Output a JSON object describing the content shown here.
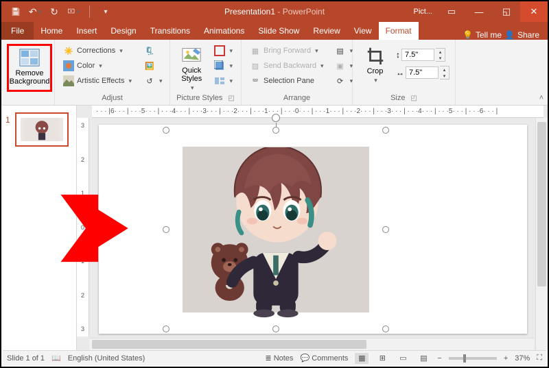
{
  "title": {
    "doc": "Presentation1",
    "app": "PowerPoint",
    "context": "Pict..."
  },
  "qat": {
    "save": "save-icon",
    "undo": "undo-icon",
    "redo": "redo-icon",
    "start": "startshow-icon"
  },
  "tabs": {
    "file": "File",
    "home": "Home",
    "insert": "Insert",
    "design": "Design",
    "transitions": "Transitions",
    "animations": "Animations",
    "slideshow": "Slide Show",
    "review": "Review",
    "view": "View",
    "format": "Format",
    "tellme": "Tell me",
    "share": "Share"
  },
  "ribbon": {
    "removebg": "Remove Background",
    "adjust": {
      "label": "Adjust",
      "corrections": "Corrections",
      "color": "Color",
      "artistic": "Artistic Effects"
    },
    "picstyles": {
      "label": "Picture Styles",
      "quick": "Quick Styles"
    },
    "arrange": {
      "label": "Arrange",
      "fwd": "Bring Forward",
      "bwd": "Send Backward",
      "pane": "Selection Pane"
    },
    "crop": "Crop",
    "size": {
      "label": "Size",
      "h": "7.5\"",
      "w": "7.5\""
    }
  },
  "thumbs": {
    "n1": "1"
  },
  "hruler": [
    "6",
    "5",
    "4",
    "3",
    "2",
    "1",
    "0",
    "1",
    "2",
    "3",
    "4",
    "5",
    "6"
  ],
  "vruler": [
    "3",
    "2",
    "1",
    "0",
    "1",
    "2",
    "3"
  ],
  "status": {
    "slide": "Slide 1 of 1",
    "lang": "English (United States)",
    "notes": "Notes",
    "comments": "Comments",
    "zoom": "37%"
  }
}
